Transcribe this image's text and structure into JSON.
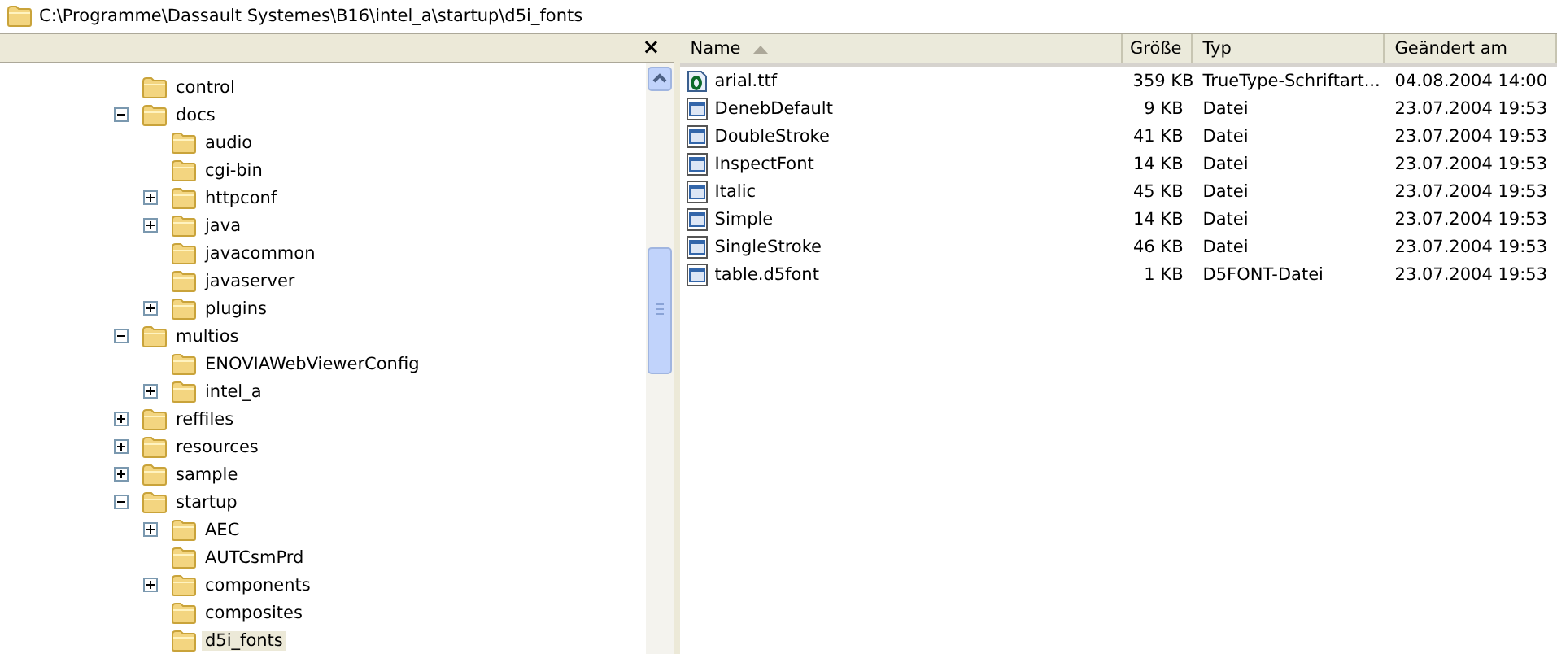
{
  "address_bar": {
    "path": "C:\\Programme\\Dassault Systemes\\B16\\intel_a\\startup\\d5i_fonts"
  },
  "folder_pane": {
    "close": "×",
    "tree": [
      {
        "name": "control",
        "kind": "leaf",
        "selected": false
      },
      {
        "name": "docs",
        "kind": "branch",
        "expanded": true,
        "selected": false,
        "children": [
          {
            "name": "audio",
            "kind": "leaf",
            "selected": false
          },
          {
            "name": "cgi-bin",
            "kind": "leaf",
            "selected": false
          },
          {
            "name": "httpconf",
            "kind": "branch",
            "expanded": false,
            "selected": false
          },
          {
            "name": "java",
            "kind": "branch",
            "expanded": false,
            "selected": false
          },
          {
            "name": "javacommon",
            "kind": "leaf",
            "selected": false
          },
          {
            "name": "javaserver",
            "kind": "leaf",
            "selected": false
          },
          {
            "name": "plugins",
            "kind": "branch",
            "expanded": false,
            "selected": false
          }
        ]
      },
      {
        "name": "multios",
        "kind": "branch",
        "expanded": true,
        "selected": false,
        "children": [
          {
            "name": "ENOVIAWebViewerConfig",
            "kind": "leaf",
            "selected": false
          },
          {
            "name": "intel_a",
            "kind": "branch",
            "expanded": false,
            "selected": false
          }
        ]
      },
      {
        "name": "reffiles",
        "kind": "branch",
        "expanded": false,
        "selected": false
      },
      {
        "name": "resources",
        "kind": "branch",
        "expanded": false,
        "selected": false
      },
      {
        "name": "sample",
        "kind": "branch",
        "expanded": false,
        "selected": false
      },
      {
        "name": "startup",
        "kind": "branch",
        "expanded": true,
        "selected": false,
        "children": [
          {
            "name": "AEC",
            "kind": "branch",
            "expanded": false,
            "selected": false
          },
          {
            "name": "AUTCsmPrd",
            "kind": "leaf",
            "selected": false
          },
          {
            "name": "components",
            "kind": "branch",
            "expanded": false,
            "selected": false
          },
          {
            "name": "composites",
            "kind": "leaf",
            "selected": false
          },
          {
            "name": "d5i_fonts",
            "kind": "leaf",
            "selected": true
          }
        ]
      }
    ]
  },
  "file_list": {
    "columns": [
      "Name",
      "Größe",
      "Typ",
      "Geändert am"
    ],
    "rows": [
      {
        "kind": "font",
        "name": "arial.ttf",
        "size": "359 KB",
        "type": "TrueType-Schriftart...",
        "modified": "04.08.2004 14:00"
      },
      {
        "kind": "file",
        "name": "DenebDefault",
        "size": "9 KB",
        "type": "Datei",
        "modified": "23.07.2004 19:53"
      },
      {
        "kind": "file",
        "name": "DoubleStroke",
        "size": "41 KB",
        "type": "Datei",
        "modified": "23.07.2004 19:53"
      },
      {
        "kind": "file",
        "name": "InspectFont",
        "size": "14 KB",
        "type": "Datei",
        "modified": "23.07.2004 19:53"
      },
      {
        "kind": "file",
        "name": "Italic",
        "size": "45 KB",
        "type": "Datei",
        "modified": "23.07.2004 19:53"
      },
      {
        "kind": "file",
        "name": "Simple",
        "size": "14 KB",
        "type": "Datei",
        "modified": "23.07.2004 19:53"
      },
      {
        "kind": "file",
        "name": "SingleStroke",
        "size": "46 KB",
        "type": "Datei",
        "modified": "23.07.2004 19:53"
      },
      {
        "kind": "file",
        "name": "table.d5font",
        "size": "1 KB",
        "type": "D5FONT-Datei",
        "modified": "23.07.2004 19:53"
      }
    ]
  }
}
